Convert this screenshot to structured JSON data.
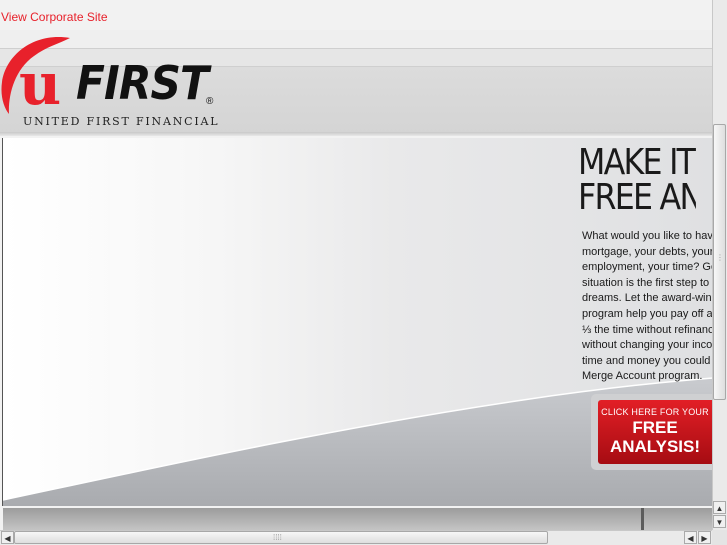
{
  "header": {
    "corporate_link": "View Corporate Site",
    "logo_letter": "u",
    "logo_word": "FIRST",
    "logo_registered": "®",
    "logo_tagline": "UNITED FIRST FINANCIAL"
  },
  "hero": {
    "headline_line1": "MAKE IT",
    "headline_line2": "FREE AN",
    "body_lines": [
      "What would you like to hav",
      "mortgage, your debts, your",
      "employment, your time? Ge",
      "situation is the first step to a",
      "dreams. Let the award-win",
      "program help you pay off a",
      "⅓ the time without refinanc",
      "without changing your inco",
      "time and money you could",
      "Merge Account program."
    ],
    "cta_small": "CLICK HERE FOR YOUR",
    "cta_line1": "FREE",
    "cta_line2": "ANALYSIS!"
  },
  "scrollbars": {
    "up_arrow": "▲",
    "down_arrow": "▼",
    "left_arrow": "◀",
    "right_arrow": "▶",
    "grip_vertical": "⋮⋮",
    "grip_horizontal": "⁞⁞⁞⁞"
  },
  "colors": {
    "brand_red": "#e8212b",
    "text_dark": "#1a1a1a"
  }
}
